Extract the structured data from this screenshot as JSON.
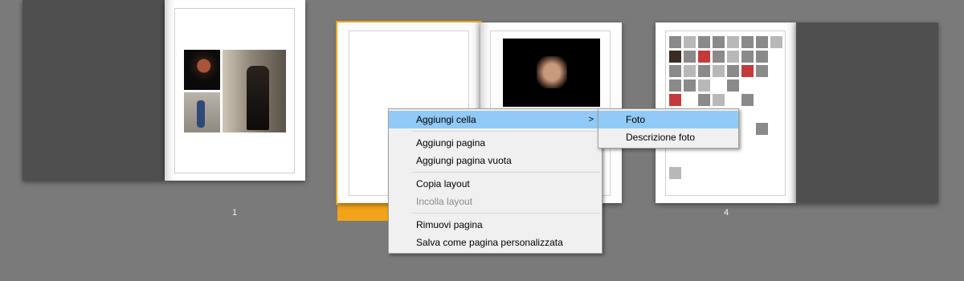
{
  "pages": {
    "page1_number": "1",
    "page4_number": "4"
  },
  "context_menu": {
    "items": [
      {
        "label": "Aggiungi cella",
        "highlighted": true,
        "has_submenu": true,
        "submenu_arrow": ">"
      },
      {
        "label": "Aggiungi pagina"
      },
      {
        "label": "Aggiungi pagina vuota"
      },
      {
        "label": "Copia layout"
      },
      {
        "label": "Incolla layout",
        "disabled": true
      },
      {
        "label": "Rimuovi pagina"
      },
      {
        "label": "Salva come pagina personalizzata"
      }
    ]
  },
  "submenu": {
    "items": [
      {
        "label": "Foto",
        "highlighted": true
      },
      {
        "label": "Descrizione foto"
      }
    ]
  },
  "colors": {
    "background": "#7a7a7a",
    "selection": "#f2a418",
    "menu_highlight": "#91c9f7",
    "dark_blank_page": "#4f4f4f"
  }
}
